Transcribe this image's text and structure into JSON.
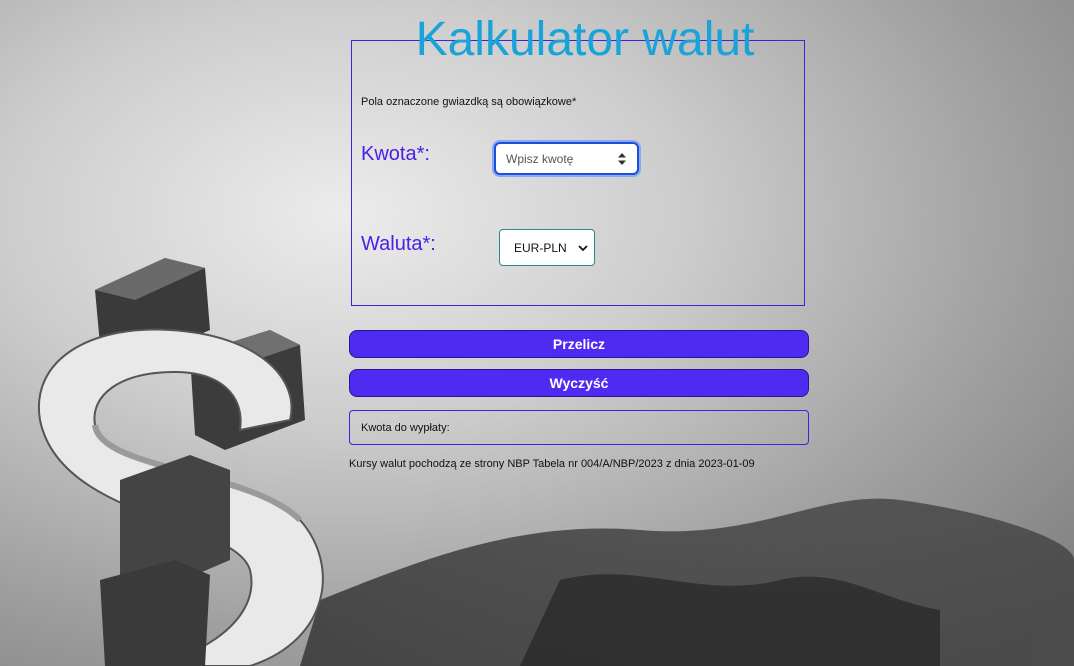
{
  "page": {
    "title": "Kalkulator walut",
    "required_note": "Pola oznaczone gwiazdką są obowiązkowe*"
  },
  "form": {
    "amount_label": "Kwota*:",
    "amount_placeholder": "Wpisz kwotę",
    "amount_value": "",
    "currency_label": "Waluta*:",
    "currency_selected": "EUR-PLN"
  },
  "buttons": {
    "calculate_label": "Przelicz",
    "clear_label": "Wyczyść"
  },
  "result": {
    "label": "Kwota do wypłaty:",
    "value": ""
  },
  "footer": {
    "source_text": "Kursy walut pochodzą ze strony NBP Tabela nr 004/A/NBP/2023 z dnia 2023-01-09"
  },
  "colors": {
    "title": "#1aa3d8",
    "label": "#4a1fe8",
    "button": "#4f2bf2",
    "border": "#3d22e0"
  },
  "icons": {
    "spinner": "spinner-arrows-icon",
    "select": "chevron-down-icon",
    "background": "dollar-sign-sculpture"
  }
}
